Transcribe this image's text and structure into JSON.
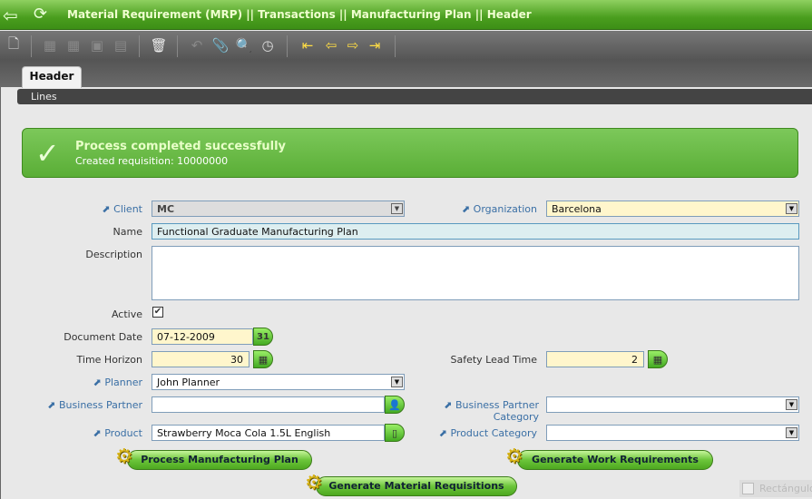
{
  "title": "Material Requirement (MRP) || Transactions || Manufacturing Plan  ||  Header",
  "tabs": {
    "header": "Header",
    "lines": "Lines"
  },
  "message": {
    "title": "Process completed successfully",
    "detail": "Created requisition: 10000000"
  },
  "fields": {
    "client": {
      "label": "Client",
      "value": "MC"
    },
    "organization": {
      "label": "Organization",
      "value": "Barcelona"
    },
    "name": {
      "label": "Name",
      "value": "Functional Graduate Manufacturing Plan"
    },
    "description": {
      "label": "Description",
      "value": ""
    },
    "active": {
      "label": "Active",
      "value": "✔"
    },
    "document_date": {
      "label": "Document Date",
      "value": "07-12-2009"
    },
    "time_horizon": {
      "label": "Time Horizon",
      "value": "30"
    },
    "safety_lead_time": {
      "label": "Safety Lead Time",
      "value": "2"
    },
    "planner": {
      "label": "Planner",
      "value": "John Planner"
    },
    "business_partner": {
      "label": "Business Partner",
      "value": ""
    },
    "bp_category": {
      "label": "Business Partner Category",
      "value": ""
    },
    "product": {
      "label": "Product",
      "value": "Strawberry Moca Cola 1.5L English"
    },
    "product_category": {
      "label": "Product Category",
      "value": ""
    }
  },
  "buttons": {
    "process": "Process Manufacturing Plan",
    "work": "Generate Work Requirements",
    "material": "Generate Material Requisitions"
  },
  "calendar_day": "31",
  "tooltip": "Rectángulo"
}
